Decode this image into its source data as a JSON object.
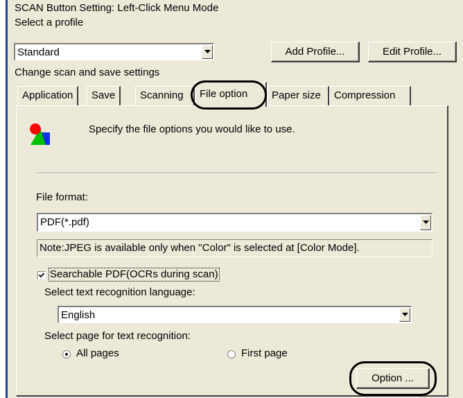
{
  "window": {
    "title": "SCAN Button Setting: Left-Click Menu Mode"
  },
  "profile": {
    "label": "Select a profile",
    "selected": "Standard",
    "add_button": "Add Profile...",
    "edit_button": "Edit Profile..."
  },
  "settings_label": "Change scan and save settings",
  "tabs": [
    {
      "label": "Application"
    },
    {
      "label": "Save"
    },
    {
      "label": "Scanning"
    },
    {
      "label": "File option"
    },
    {
      "label": "Paper size"
    },
    {
      "label": "Compression"
    }
  ],
  "active_tab": "File option",
  "file_option": {
    "description": "Specify the file options you would like to use.",
    "icon": "file-options-icon",
    "file_format_label": "File format:",
    "file_format_value": "PDF(*.pdf)",
    "note": "Note:JPEG is available only when \"Color\" is selected at [Color Mode].",
    "searchable_pdf_label": "Searchable PDF(OCRs during scan)",
    "searchable_pdf_checked": true,
    "language_label": "Select text recognition language:",
    "language_value": "English",
    "page_label": "Select page for text recognition:",
    "page_options": [
      {
        "label": "All pages",
        "selected": true
      },
      {
        "label": "First page",
        "selected": false
      }
    ],
    "option_button": "Option ..."
  },
  "colors": {
    "window_bg": "#ece9d8",
    "accent_border": "#1c3f9e",
    "callout": "#000000"
  }
}
